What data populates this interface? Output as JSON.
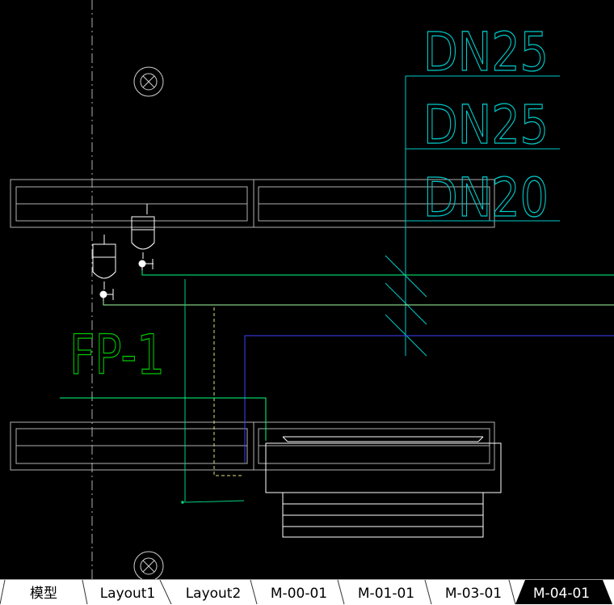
{
  "drawing": {
    "annotations": {
      "pipe_size_1": "DN25",
      "pipe_size_2": "DN25",
      "pipe_size_3": "DN20",
      "equipment_tag": "FP-1"
    },
    "colors": {
      "background": "#000000",
      "outline": "#ffffff",
      "grey_outline": "#b0b0b0",
      "dimension_cyan": "#00c8c8",
      "pipe_green": "#00ff80",
      "pipe_light_green": "#80ff80",
      "tag_green": "#00c000",
      "pipe_blue": "#4040ff",
      "pipe_yellow": "#ffff80"
    }
  },
  "layout_tabs": {
    "active_index": 6,
    "items": [
      {
        "label": "模型"
      },
      {
        "label": "Layout1"
      },
      {
        "label": "Layout2"
      },
      {
        "label": "M-00-01"
      },
      {
        "label": "M-01-01"
      },
      {
        "label": "M-03-01"
      },
      {
        "label": "M-04-01"
      }
    ]
  }
}
